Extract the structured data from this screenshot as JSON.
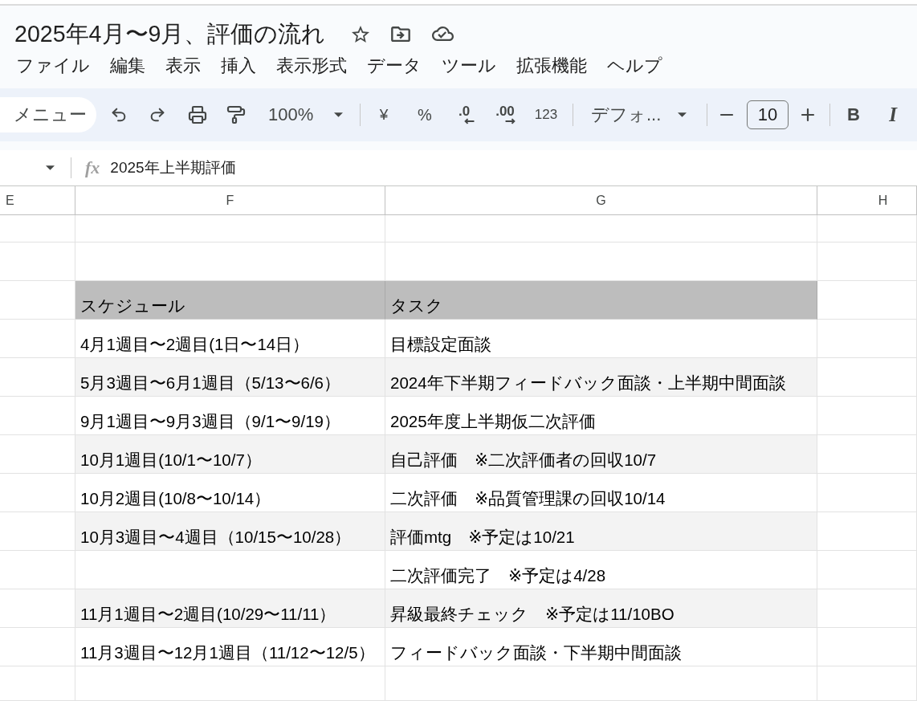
{
  "document": {
    "title": "2025年4月〜9月、評価の流れ"
  },
  "menu": [
    "ファイル",
    "編集",
    "表示",
    "挿入",
    "表示形式",
    "データ",
    "ツール",
    "拡張機能",
    "ヘルプ"
  ],
  "toolbar": {
    "menu_button": "メニュー",
    "zoom": "100%",
    "currency": "¥",
    "percent": "%",
    "decrease_decimals": ".0",
    "increase_decimals": ".00",
    "number_format": "123",
    "font": "デフォ...",
    "font_size": "10",
    "bold": "B",
    "italic": "I"
  },
  "formula_bar": {
    "label": "fx",
    "value": "2025年上半期評価"
  },
  "sheet": {
    "columns": [
      "E",
      "F",
      "G",
      "H"
    ],
    "header": {
      "schedule": "スケジュール",
      "task": "タスク"
    },
    "rows": [
      {
        "schedule": "4月1週目〜2週目(1日〜14日）",
        "task": "目標設定面談",
        "shaded": false
      },
      {
        "schedule": "5月3週目〜6月1週目（5/13〜6/6）",
        "task": "2024年下半期フィードバック面談・上半期中間面談",
        "shaded": true
      },
      {
        "schedule": "9月1週目〜9月3週目（9/1〜9/19）",
        "task": "2025年度上半期仮二次評価",
        "shaded": false
      },
      {
        "schedule": "10月1週目(10/1〜10/7）",
        "task": "自己評価　※二次評価者の回収10/7",
        "shaded": true
      },
      {
        "schedule": "10月2週目(10/8〜10/14）",
        "task": "二次評価　※品質管理課の回収10/14",
        "shaded": false
      },
      {
        "schedule": "10月3週目〜4週目（10/15〜10/28）",
        "task": "評価mtg　※予定は10/21",
        "shaded": true
      },
      {
        "task": "二次評価完了　※予定は4/28",
        "shaded": false
      },
      {
        "schedule": "11月1週目〜2週目(10/29〜11/11）",
        "task": "昇級最終チェック　※予定は11/10BO",
        "shaded": true
      },
      {
        "schedule": "11月3週目〜12月1週目（11/12〜12/5）",
        "task": "フィードバック面談・下半期中間面談",
        "shaded": false
      }
    ]
  }
}
